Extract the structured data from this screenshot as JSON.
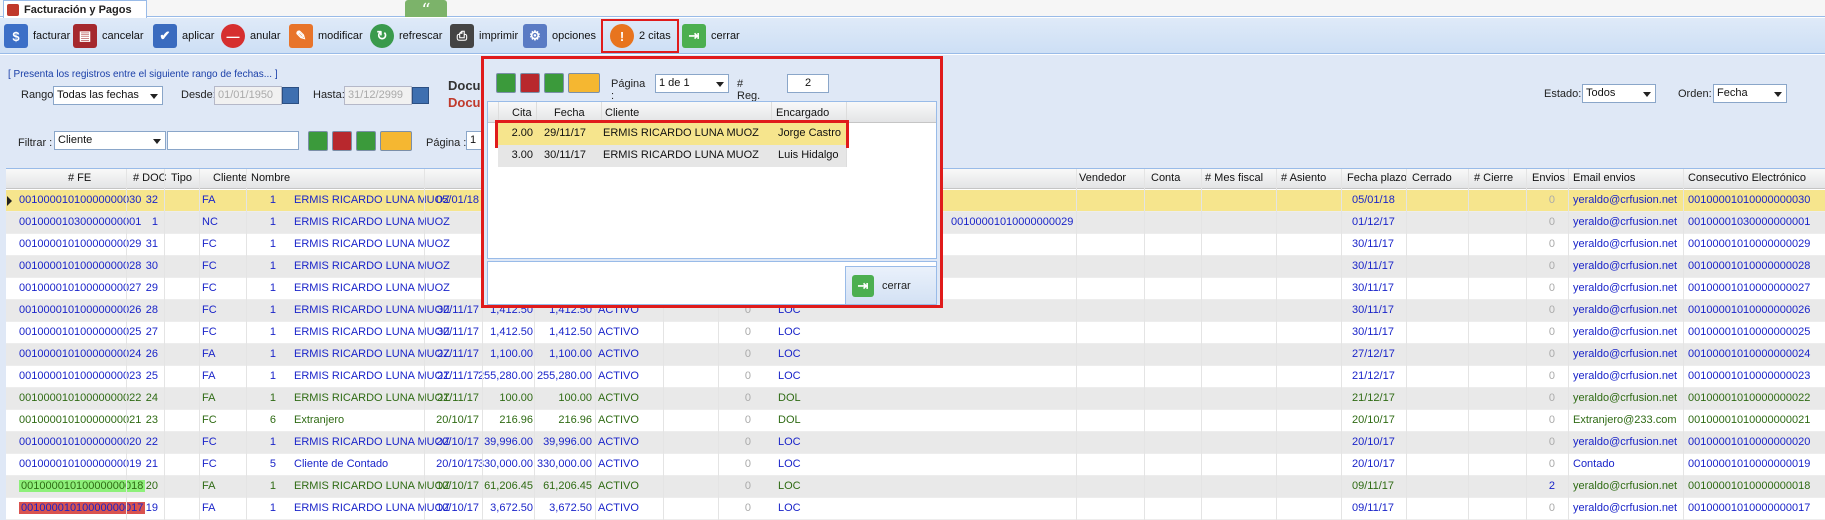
{
  "app": {
    "tab_title": "Facturación y Pagos"
  },
  "toolbar": {
    "facturar": "facturar",
    "cancelar": "cancelar",
    "aplicar": "aplicar",
    "anular": "anular",
    "modificar": "modificar",
    "refrescar": "refrescar",
    "imprimir": "imprimir",
    "opciones": "opciones",
    "citas": "2 citas",
    "cerrar": "cerrar"
  },
  "filter": {
    "range_info": "[ Presenta los registros entre el siguiente rango de fechas... ]",
    "rango_label": "Rango:",
    "rango_value": "Todas las fechas",
    "desde_label": "Desde:",
    "desde_value": "01/01/1950",
    "hasta_label": "Hasta:",
    "hasta_value": "31/12/2999",
    "doc_title1": "Docu",
    "doc_title2": "Docu",
    "estado_label": "Estado:",
    "estado_value": "Todos",
    "orden_label": "Orden:",
    "orden_value": "Fecha",
    "filtrar_label": "Filtrar :",
    "filtrar_value": "Cliente",
    "filtrar_text": "",
    "pagina_label": "Página :",
    "pagina_value": "1"
  },
  "grid": {
    "headers": [
      "# FE",
      "# DOC",
      "Tipo",
      "Cliente",
      "Nombre",
      "Vendedor",
      "Conta",
      "# Mes fiscal",
      "# Asiento",
      "Fecha plazo",
      "Cerrado",
      "# Cierre",
      "Envios",
      "Email envios",
      "Consecutivo Electrónico"
    ],
    "rows": [
      {
        "fe": "00100001010000000030",
        "doc": "32",
        "tipo": "FA",
        "cli": "1",
        "nom": "ERMIS RICARDO LUNA MUOZ",
        "fecha": "05/01/18",
        "m1": "",
        "m2": "",
        "est": "",
        "z": "",
        "loc": "",
        "ref": "",
        "plazo": "05/01/18",
        "env": "0",
        "email": "yeraldo@crfusion.net",
        "cons": "00100001010000000030",
        "style": "sel"
      },
      {
        "fe": "00100001030000000001",
        "doc": "1",
        "tipo": "NC",
        "cli": "1",
        "nom": "ERMIS RICARDO LUNA MUOZ",
        "fecha": "",
        "m1": "",
        "m2": "",
        "est": "",
        "z": "",
        "loc": "",
        "ref": "00100001010000000029",
        "plazo": "01/12/17",
        "env": "0",
        "email": "yeraldo@crfusion.net",
        "cons": "00100001030000000001",
        "style": "alt"
      },
      {
        "fe": "00100001010000000029",
        "doc": "31",
        "tipo": "FC",
        "cli": "1",
        "nom": "ERMIS RICARDO LUNA MUOZ",
        "fecha": "",
        "m1": "",
        "m2": "",
        "est": "",
        "z": "",
        "loc": "",
        "ref": "",
        "plazo": "30/11/17",
        "env": "0",
        "email": "yeraldo@crfusion.net",
        "cons": "00100001010000000029",
        "style": ""
      },
      {
        "fe": "00100001010000000028",
        "doc": "30",
        "tipo": "FC",
        "cli": "1",
        "nom": "ERMIS RICARDO LUNA MUOZ",
        "fecha": "",
        "m1": "",
        "m2": "",
        "est": "",
        "z": "",
        "loc": "",
        "ref": "",
        "plazo": "30/11/17",
        "env": "0",
        "email": "yeraldo@crfusion.net",
        "cons": "00100001010000000028",
        "style": "alt"
      },
      {
        "fe": "00100001010000000027",
        "doc": "29",
        "tipo": "FC",
        "cli": "1",
        "nom": "ERMIS RICARDO LUNA MUOZ",
        "fecha": "",
        "m1": "",
        "m2": "",
        "est": "",
        "z": "",
        "loc": "",
        "ref": "",
        "plazo": "30/11/17",
        "env": "0",
        "email": "yeraldo@crfusion.net",
        "cons": "00100001010000000027",
        "style": ""
      },
      {
        "fe": "00100001010000000026",
        "doc": "28",
        "tipo": "FC",
        "cli": "1",
        "nom": "ERMIS RICARDO LUNA MUOZ",
        "fecha": "30/11/17",
        "m1": "1,412.50",
        "m2": "1,412.50",
        "est": "ACTIVO",
        "z": "0",
        "loc": "LOC",
        "ref": "",
        "plazo": "30/11/17",
        "env": "0",
        "email": "yeraldo@crfusion.net",
        "cons": "00100001010000000026",
        "style": "alt"
      },
      {
        "fe": "00100001010000000025",
        "doc": "27",
        "tipo": "FC",
        "cli": "1",
        "nom": "ERMIS RICARDO LUNA MUOZ",
        "fecha": "30/11/17",
        "m1": "1,412.50",
        "m2": "1,412.50",
        "est": "ACTIVO",
        "z": "0",
        "loc": "LOC",
        "ref": "",
        "plazo": "30/11/17",
        "env": "0",
        "email": "yeraldo@crfusion.net",
        "cons": "00100001010000000025",
        "style": ""
      },
      {
        "fe": "00100001010000000024",
        "doc": "26",
        "tipo": "FA",
        "cli": "1",
        "nom": "ERMIS RICARDO LUNA MUOZ",
        "fecha": "27/11/17",
        "m1": "1,100.00",
        "m2": "1,100.00",
        "est": "ACTIVO",
        "z": "0",
        "loc": "LOC",
        "ref": "",
        "plazo": "27/12/17",
        "env": "0",
        "email": "yeraldo@crfusion.net",
        "cons": "00100001010000000024",
        "style": "alt"
      },
      {
        "fe": "00100001010000000023",
        "doc": "25",
        "tipo": "FA",
        "cli": "1",
        "nom": "ERMIS RICARDO LUNA MUOZ",
        "fecha": "21/11/17",
        "m1": "255,280.00",
        "m2": "255,280.00",
        "est": "ACTIVO",
        "z": "0",
        "loc": "LOC",
        "ref": "",
        "plazo": "21/12/17",
        "env": "0",
        "email": "yeraldo@crfusion.net",
        "cons": "00100001010000000023",
        "style": ""
      },
      {
        "fe": "00100001010000000022",
        "doc": "24",
        "tipo": "FA",
        "cli": "1",
        "nom": "ERMIS RICARDO LUNA MUOZ",
        "fecha": "21/11/17",
        "m1": "100.00",
        "m2": "100.00",
        "est": "ACTIVO",
        "z": "0",
        "loc": "DOL",
        "ref": "",
        "plazo": "21/12/17",
        "env": "0",
        "email": "yeraldo@crfusion.net",
        "cons": "00100001010000000022",
        "style": "alt green"
      },
      {
        "fe": "00100001010000000021",
        "doc": "23",
        "tipo": "FC",
        "cli": "6",
        "nom": "Extranjero",
        "fecha": "20/10/17",
        "m1": "216.96",
        "m2": "216.96",
        "est": "ACTIVO",
        "z": "0",
        "loc": "DOL",
        "ref": "",
        "plazo": "20/10/17",
        "env": "0",
        "email": "Extranjero@233.com",
        "cons": "00100001010000000021",
        "style": "green"
      },
      {
        "fe": "00100001010000000020",
        "doc": "22",
        "tipo": "FC",
        "cli": "1",
        "nom": "ERMIS RICARDO LUNA MUOZ",
        "fecha": "20/10/17",
        "m1": "39,996.00",
        "m2": "39,996.00",
        "est": "ACTIVO",
        "z": "0",
        "loc": "LOC",
        "ref": "",
        "plazo": "20/10/17",
        "env": "0",
        "email": "yeraldo@crfusion.net",
        "cons": "00100001010000000020",
        "style": "alt"
      },
      {
        "fe": "00100001010000000019",
        "doc": "21",
        "tipo": "FC",
        "cli": "5",
        "nom": "Cliente de Contado",
        "fecha": "20/10/17",
        "m1": "330,000.00",
        "m2": "330,000.00",
        "est": "ACTIVO",
        "z": "0",
        "loc": "LOC",
        "ref": "",
        "plazo": "20/10/17",
        "env": "0",
        "email": "Contado",
        "cons": "00100001010000000019",
        "style": ""
      },
      {
        "fe": "00100001010000000018",
        "doc": "20",
        "tipo": "FA",
        "cli": "1",
        "nom": "ERMIS RICARDO LUNA MUOZ",
        "fecha": "10/10/17",
        "m1": "61,206.45",
        "m2": "61,206.45",
        "est": "ACTIVO",
        "z": "0",
        "loc": "LOC",
        "ref": "",
        "plazo": "09/11/17",
        "env": "2",
        "email": "yeraldo@crfusion.net",
        "cons": "00100001010000000018",
        "style": "alt hlgreen"
      },
      {
        "fe": "00100001010000000017",
        "doc": "19",
        "tipo": "FA",
        "cli": "1",
        "nom": "ERMIS RICARDO LUNA MUOZ",
        "fecha": "10/10/17",
        "m1": "3,672.50",
        "m2": "3,672.50",
        "est": "ACTIVO",
        "z": "0",
        "loc": "LOC",
        "ref": "",
        "plazo": "09/11/17",
        "env": "0",
        "email": "yeraldo@crfusion.net",
        "cons": "00100001010000000017",
        "style": "hlred"
      }
    ]
  },
  "popup": {
    "pagina_label": "Página :",
    "pagina_value": "1 de 1",
    "reg_label": "# Reg. :",
    "reg_value": "2",
    "headers": [
      "Cita",
      "Fecha",
      "Cliente",
      "Encargado"
    ],
    "rows": [
      {
        "cita": "2.00",
        "fecha": "29/11/17",
        "cliente": "ERMIS RICARDO LUNA MUOZ",
        "enc": "Jorge Castro"
      },
      {
        "cita": "3.00",
        "fecha": "30/11/17",
        "cliente": "ERMIS RICARDO LUNA MUOZ",
        "enc": "Luis Hidalgo"
      }
    ],
    "close_label": "cerrar"
  },
  "colors": {
    "link_blue": "#1a24c9",
    "green_text": "#2f6b14",
    "sel_row": "#f6e58d",
    "alt_row": "#e9e9e9",
    "hl_green": "#8ef07a",
    "hl_red": "#d9534f"
  }
}
